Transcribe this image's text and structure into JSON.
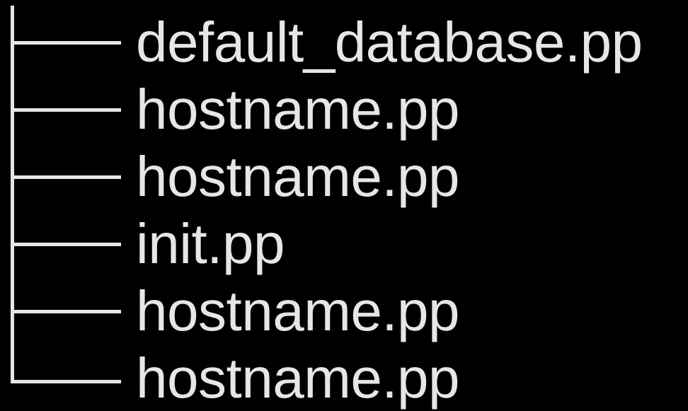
{
  "colors": {
    "background": "#000000",
    "foreground": "#e6e6e6"
  },
  "tree": {
    "items": [
      {
        "label": "default_database.pp"
      },
      {
        "label": "hostname.pp"
      },
      {
        "label": "hostname.pp"
      },
      {
        "label": "init.pp"
      },
      {
        "label": "hostname.pp"
      },
      {
        "label": "hostname.pp"
      }
    ]
  }
}
